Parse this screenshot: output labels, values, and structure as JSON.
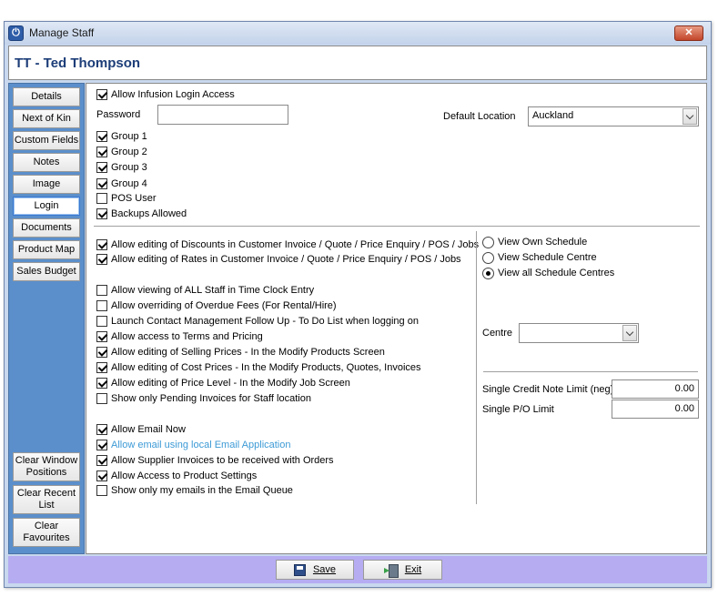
{
  "window": {
    "title": "Manage Staff",
    "close_glyph": "✕"
  },
  "header": {
    "title": "TT - Ted Thompson"
  },
  "sidebar": {
    "items": [
      "Details",
      "Next of Kin",
      "Custom Fields",
      "Notes",
      "Image",
      "Login",
      "Documents",
      "Product Map",
      "Sales Budget"
    ],
    "active": "Login",
    "bottom": [
      "Clear Window Positions",
      "Clear Recent List",
      "Clear Favourites"
    ]
  },
  "login": {
    "allow_login": {
      "label": "Allow Infusion Login Access",
      "checked": true
    },
    "password_label": "Password",
    "password_value": "",
    "default_location_label": "Default Location",
    "default_location_value": "Auckland",
    "groups": [
      {
        "label": "Group 1",
        "checked": true
      },
      {
        "label": "Group 2",
        "checked": true
      },
      {
        "label": "Group 3",
        "checked": true
      },
      {
        "label": "Group 4",
        "checked": true
      },
      {
        "label": "POS User",
        "checked": false
      },
      {
        "label": "Backups Allowed",
        "checked": true
      }
    ]
  },
  "permissions": {
    "pricing": [
      {
        "label": "Allow editing of Discounts in Customer Invoice / Quote / Price Enquiry / POS / Jobs",
        "checked": true
      },
      {
        "label": "Allow editing of Rates in Customer Invoice / Quote / Price Enquiry / POS / Jobs",
        "checked": true
      }
    ],
    "general": [
      {
        "label": "Allow viewing of ALL Staff in Time Clock Entry",
        "checked": false
      },
      {
        "label": "Allow overriding of Overdue Fees (For Rental/Hire)",
        "checked": false
      },
      {
        "label": "Launch Contact Management Follow Up - To Do List when logging on",
        "checked": false
      },
      {
        "label": "Allow access to Terms and Pricing",
        "checked": true
      },
      {
        "label": "Allow editing of Selling Prices - In the Modify Products Screen",
        "checked": true
      },
      {
        "label": "Allow editing of Cost Prices - In the Modify Products, Quotes, Invoices",
        "checked": true
      },
      {
        "label": "Allow editing of Price Level - In the Modify Job Screen",
        "checked": true
      },
      {
        "label": "Show only Pending Invoices for Staff location",
        "checked": false
      }
    ],
    "email": [
      {
        "label": "Allow Email Now",
        "checked": true,
        "link": false
      },
      {
        "label": "Allow email using local Email Application",
        "checked": true,
        "link": true
      },
      {
        "label": "Allow Supplier Invoices to be received with Orders",
        "checked": true,
        "link": false
      },
      {
        "label": "Allow Access to Product Settings",
        "checked": true,
        "link": false
      },
      {
        "label": "Show only my emails in the Email Queue",
        "checked": false,
        "link": false
      }
    ]
  },
  "schedule": {
    "options": [
      {
        "label": "View Own Schedule",
        "checked": false
      },
      {
        "label": "View Schedule Centre",
        "checked": false
      },
      {
        "label": "View all Schedule Centres",
        "checked": true
      }
    ],
    "centre_label": "Centre",
    "centre_value": ""
  },
  "limits": {
    "credit_note_label": "Single Credit Note Limit (neg)",
    "credit_note_value": "0.00",
    "po_label": "Single P/O Limit",
    "po_value": "0.00"
  },
  "footer": {
    "save_label": "Save",
    "exit_label": "Exit"
  }
}
